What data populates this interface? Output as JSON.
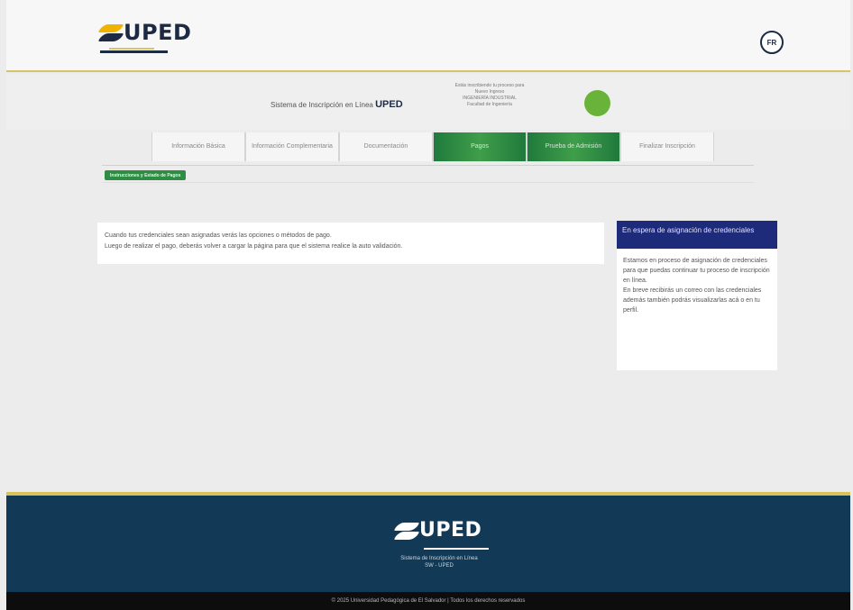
{
  "header": {
    "logo_text": "UPED",
    "user_initials": "FR"
  },
  "subheader": {
    "title_prefix": "Sistema de Inscripción en Línea",
    "title_brand": "UPED",
    "info_lines": [
      "Estás inscribiendo tu proceso para",
      "Nuevo Ingreso",
      "INGENIERÍA INDUSTRIAL",
      "Facultad de Ingeniería"
    ],
    "status_color": "#6ab33a"
  },
  "tabs": [
    {
      "label": "Información Básica",
      "active": false
    },
    {
      "label": "Información Complementaria",
      "active": false
    },
    {
      "label": "Documentación",
      "active": false
    },
    {
      "label": "Pagos",
      "active": true
    },
    {
      "label": "Prueba de Admisión",
      "active": true
    },
    {
      "label": "Finalizar Inscripción",
      "active": false
    }
  ],
  "section_pill": "Instrucciones y Estado de Pagos",
  "message": {
    "line1": "Cuando tus credenciales sean asignadas verás las opciones o métodos de pago.",
    "line2": "Luego de realizar el pago, deberás volver a cargar la página para que el sistema realice la auto validación."
  },
  "card": {
    "title": "En espera de asignación de credenciales",
    "body1": "Estamos en proceso de asignación de credenciales para que puedas continuar tu proceso de inscripción en línea.",
    "body2": "En breve recibirás un correo con las credenciales además también podrás visualizarlas acá o en tu perfil."
  },
  "footer": {
    "logo_text": "UPED",
    "line1": "Sistema de Inscripción en Línea",
    "line2": "SW - UPED",
    "copyright": "© 2025 Universidad Pedagógica de El Salvador | Todos los derechos reservados"
  },
  "colors": {
    "brand_navy": "#1d2a44",
    "brand_gold": "#d7c46a",
    "tab_active": "#2d8e43",
    "card_header": "#1e2a7a",
    "footer_bg": "#123a57"
  }
}
